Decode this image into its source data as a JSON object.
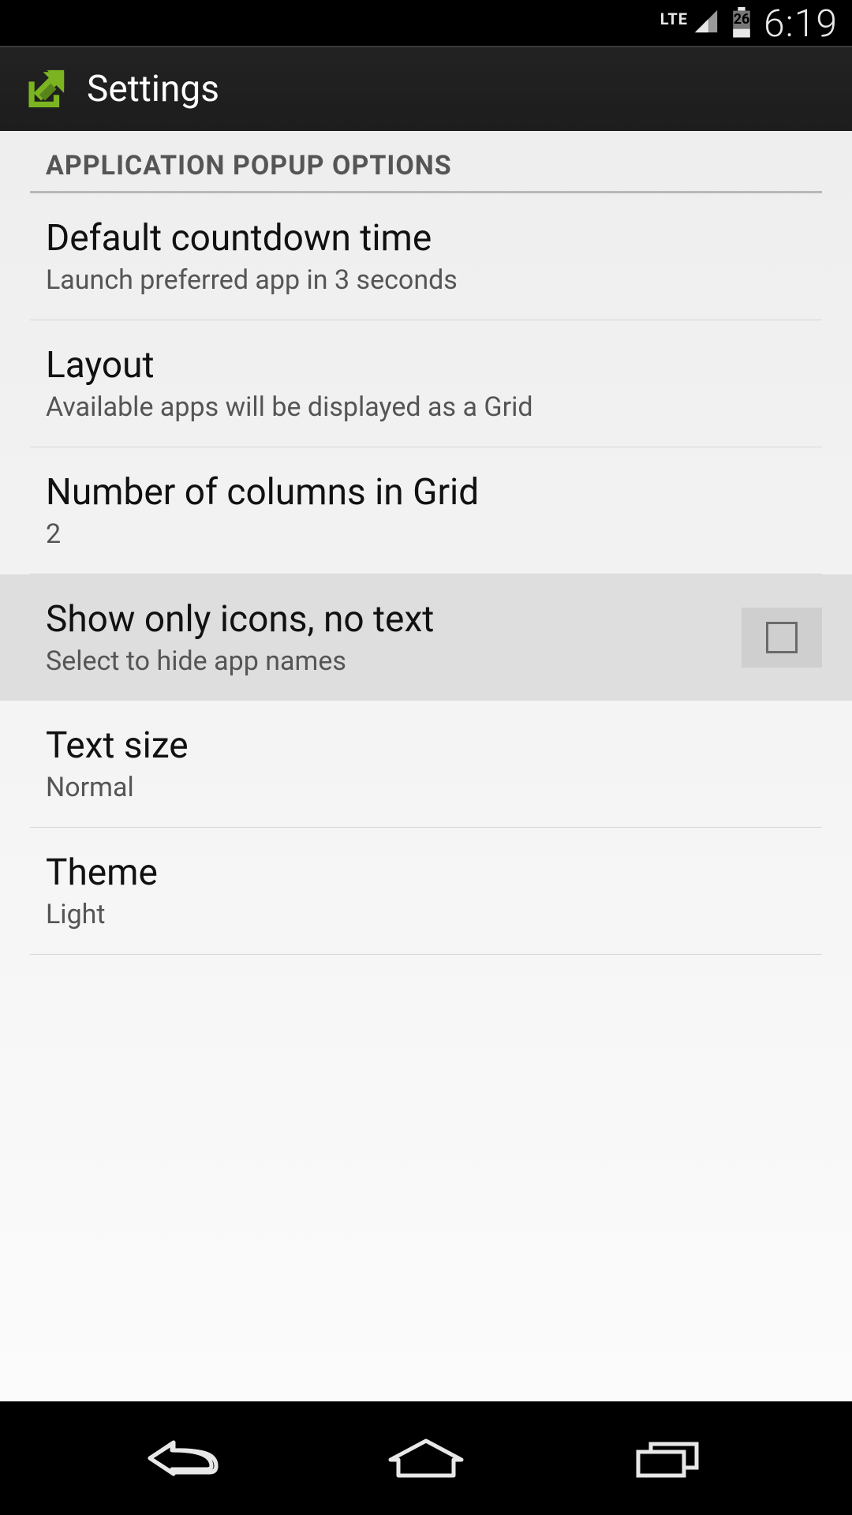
{
  "status": {
    "network": "LTE",
    "battery": "26",
    "time": "6:19",
    "icons": {
      "signal": "signal-icon",
      "battery": "battery-icon"
    }
  },
  "header": {
    "icon": "share-arrow-icon",
    "title": "Settings",
    "accent": "#7bb420"
  },
  "section": {
    "title": "APPLICATION POPUP OPTIONS"
  },
  "items": [
    {
      "title": "Default countdown time",
      "sub": "Launch preferred app in 3 seconds"
    },
    {
      "title": "Layout",
      "sub": "Available apps will be displayed as a Grid"
    },
    {
      "title": "Number of columns in Grid",
      "sub": "2"
    },
    {
      "title": "Show only icons, no text",
      "sub": "Select to hide app names",
      "checkbox": true,
      "checked": false,
      "highlight": true
    },
    {
      "title": "Text size",
      "sub": "Normal"
    },
    {
      "title": "Theme",
      "sub": "Light"
    }
  ],
  "nav": {
    "back": "back-icon",
    "home": "home-icon",
    "recent": "recent-apps-icon"
  }
}
